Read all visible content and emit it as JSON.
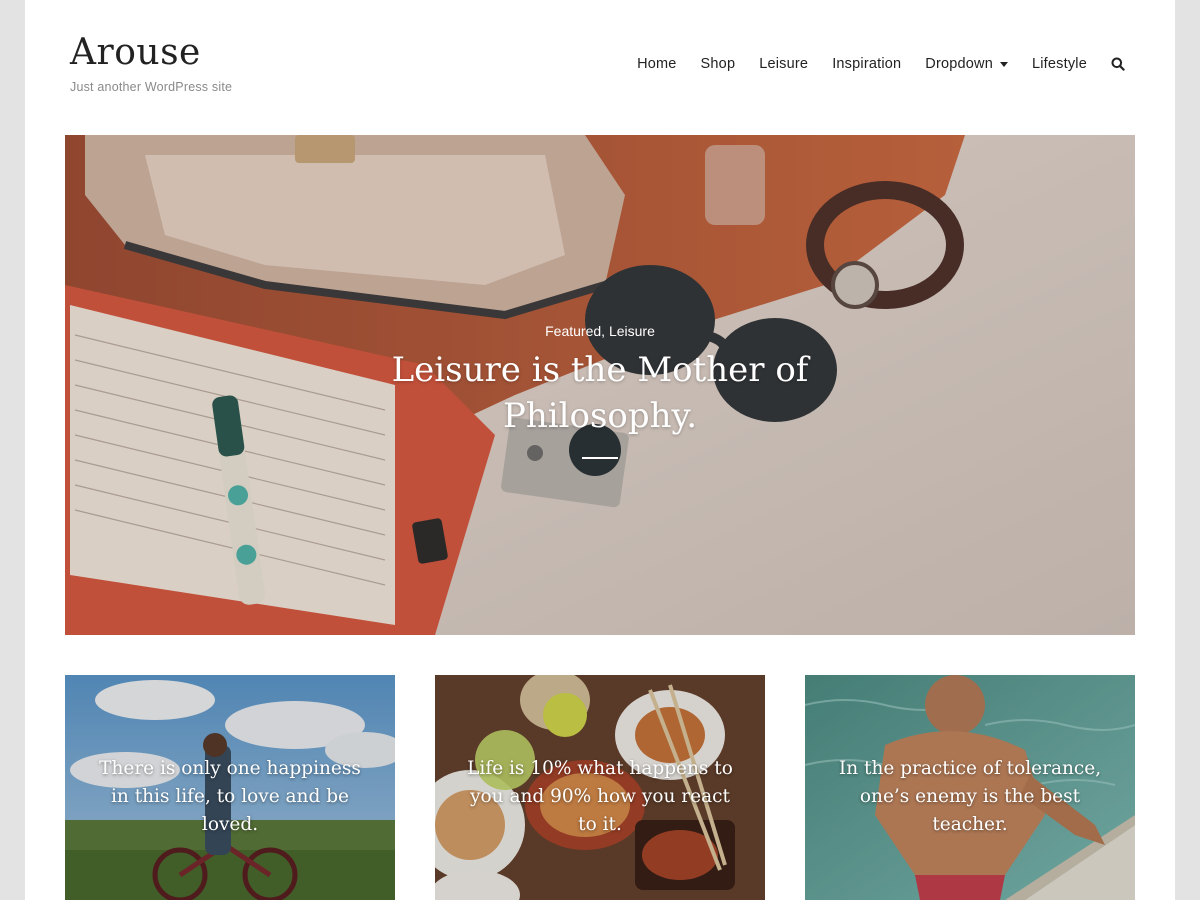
{
  "site": {
    "title": "Arouse",
    "tagline": "Just another WordPress site"
  },
  "nav": {
    "items": [
      {
        "label": "Home"
      },
      {
        "label": "Shop"
      },
      {
        "label": "Leisure"
      },
      {
        "label": "Inspiration"
      },
      {
        "label": "Dropdown",
        "has_dropdown": true
      },
      {
        "label": "Lifestyle"
      }
    ],
    "search_icon": "search-icon"
  },
  "hero": {
    "categories": [
      "Featured",
      "Leisure"
    ],
    "separator": ",",
    "title": "Leisure is the Mother of Philosophy."
  },
  "cards": [
    {
      "title": "There is only one happiness in this life, to love and be loved."
    },
    {
      "title": "Life is 10% what happens to you and 90% how you react to it."
    },
    {
      "title": "In the practice of tolerance, one’s enemy is the best teacher."
    }
  ],
  "colors": {
    "page_background": "#e3e3e3",
    "content_background": "#ffffff",
    "text": "#222222",
    "tagline": "#8a8a8a"
  }
}
